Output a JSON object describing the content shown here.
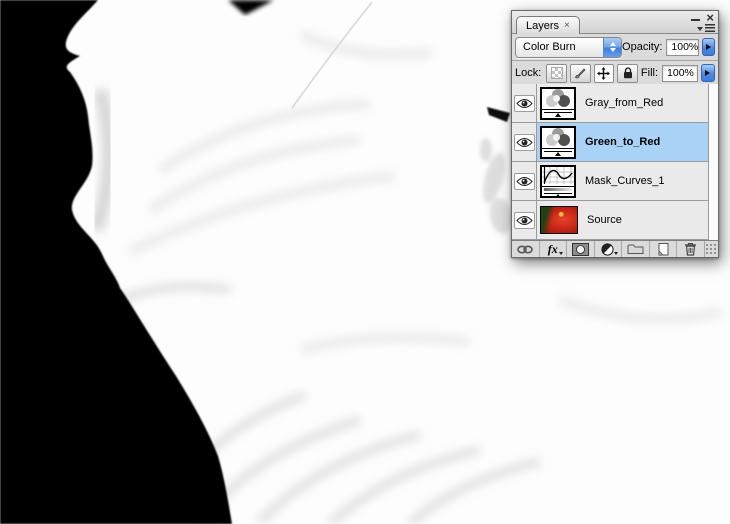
{
  "canvas": {
    "colors": {
      "background_black": "#000000",
      "background_white": "#FFFFFF"
    }
  },
  "panel": {
    "tab_label": "Layers",
    "tab_close": "×",
    "window_minimize": "–",
    "window_close": "×",
    "blend_mode_value": "Color Burn",
    "opacity_label": "Opacity:",
    "opacity_value": "100%",
    "lock_label": "Lock:",
    "fill_label": "Fill:",
    "fill_value": "100%",
    "layers": [
      {
        "name": "Gray_from_Red",
        "type": "channel-mixer-adjustment",
        "visible": true,
        "selected": false
      },
      {
        "name": "Green_to_Red",
        "type": "channel-mixer-adjustment",
        "visible": true,
        "selected": true
      },
      {
        "name": "Mask_Curves_1",
        "type": "curves-adjustment",
        "visible": true,
        "selected": false
      },
      {
        "name": "Source",
        "type": "image",
        "visible": true,
        "selected": false
      }
    ],
    "toolbar": {
      "fx_label": "fx"
    },
    "colors": {
      "selection": "#A9D2F6",
      "aqua_button": "#3B7BDC"
    }
  }
}
